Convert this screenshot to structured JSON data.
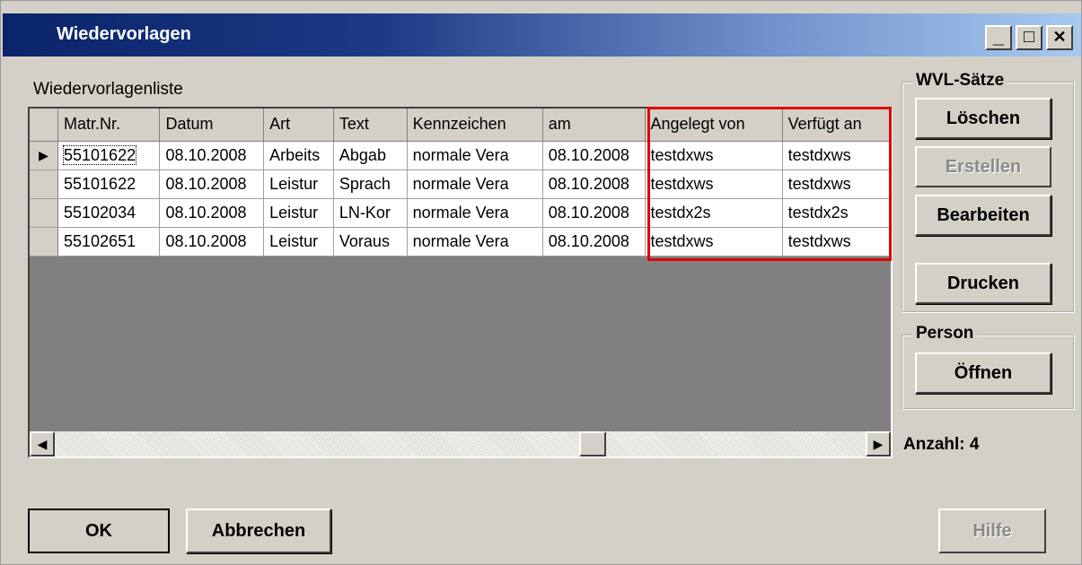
{
  "window": {
    "title": "Wiedervorlagen",
    "min_glyph": "_",
    "max_glyph": "□",
    "close_glyph": "✕"
  },
  "list": {
    "frame_label": "Wiedervorlagenliste",
    "columns": [
      "Matr.Nr.",
      "Datum",
      "Art",
      "Text",
      "Kennzeichen",
      "am",
      "Angelegt von",
      "Verfügt an"
    ],
    "rows": [
      [
        "55101622",
        "08.10.2008",
        "Arbeits",
        "Abgab",
        "normale Vera",
        "08.10.2008",
        "testdxws",
        "testdxws"
      ],
      [
        "55101622",
        "08.10.2008",
        "Leistur",
        "Sprach",
        "normale Vera",
        "08.10.2008",
        "testdxws",
        "testdxws"
      ],
      [
        "55102034",
        "08.10.2008",
        "Leistur",
        "LN-Kor",
        "normale Vera",
        "08.10.2008",
        "testdx2s",
        "testdx2s"
      ],
      [
        "55102651",
        "08.10.2008",
        "Leistur",
        "Voraus",
        "normale Vera",
        "08.10.2008",
        "testdxws",
        "testdxws"
      ]
    ],
    "current_row_marker": "▶",
    "highlight_color": "#e00000"
  },
  "scrollbar": {
    "left_arrow": "◀",
    "right_arrow": "▶"
  },
  "wvl_group": {
    "caption": "WVL-Sätze",
    "buttons": [
      "Löschen",
      "Erstellen",
      "Bearbeiten",
      "Drucken"
    ]
  },
  "person_group": {
    "caption": "Person",
    "open_label": "Öffnen"
  },
  "count_text": "Anzahl: 4",
  "footer": {
    "ok_label": "OK",
    "cancel_label": "Abbrechen",
    "help_label": "Hilfe"
  }
}
